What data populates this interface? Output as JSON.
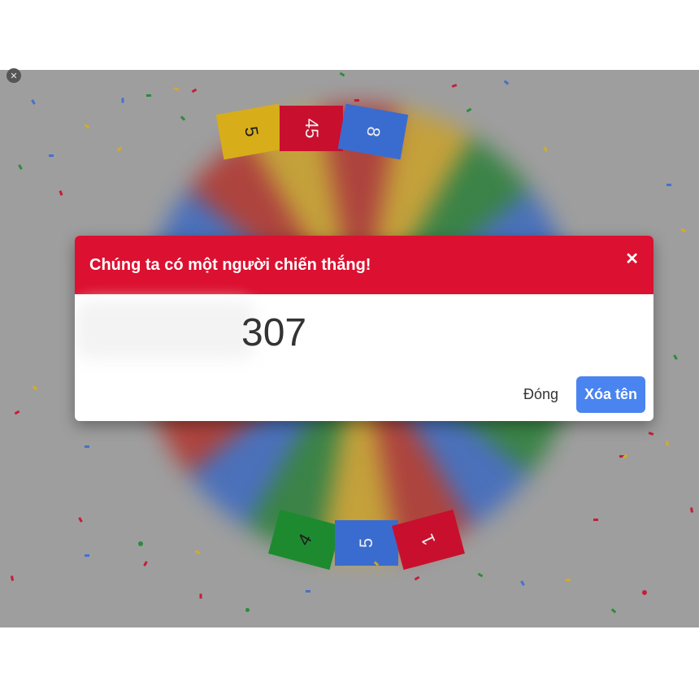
{
  "wheel": {
    "top_labels": [
      "5",
      "45",
      "8"
    ],
    "bottom_labels": [
      "4",
      "5",
      "1"
    ]
  },
  "dialog": {
    "title": "Chúng ta có một người chiến thắng!",
    "close_icon": "✕",
    "winner_text": "307",
    "buttons": {
      "close_label": "Đóng",
      "remove_label": "Xóa tên"
    }
  },
  "side_close_icon": "✕",
  "colors": {
    "header": "#dc1030",
    "primary_button": "#4a84f0",
    "overlay": "#9e9e9e"
  }
}
